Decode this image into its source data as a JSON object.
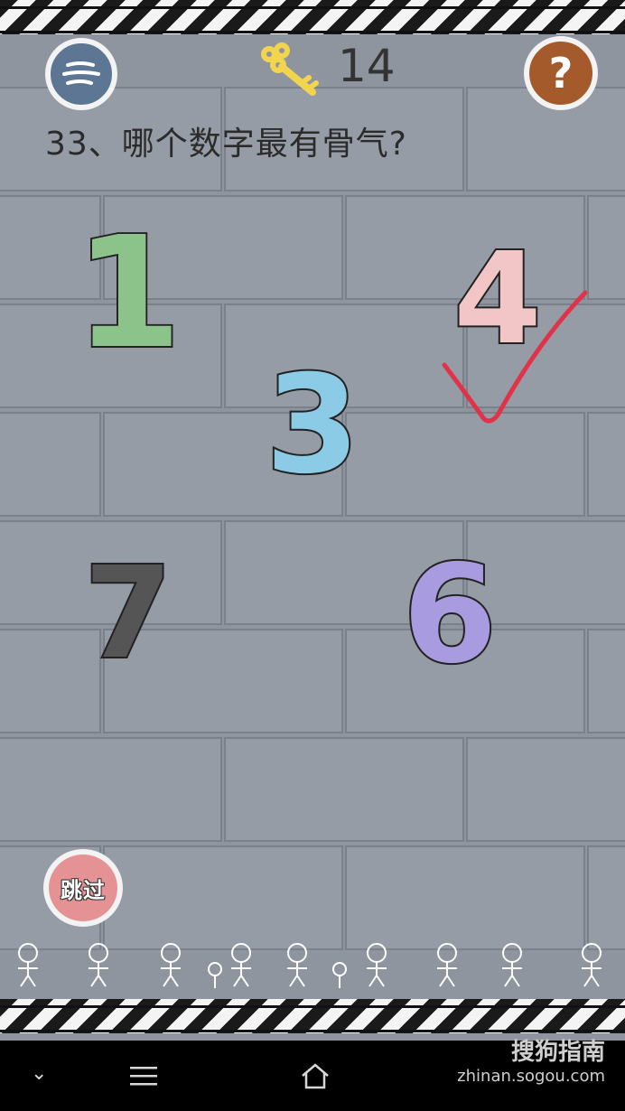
{
  "header": {
    "key_count": "14",
    "help_label": "?"
  },
  "question": {
    "text": "33、哪个数字最有骨气?"
  },
  "choices": [
    "1",
    "4",
    "3",
    "7",
    "6"
  ],
  "correct_choice": "4",
  "skip_button": {
    "label": "跳过"
  },
  "watermark": {
    "title": "搜狗指南",
    "url": "zhinan.sogou.com"
  },
  "colors": {
    "wall": "#8e959f",
    "check_mark": "#e0334a",
    "key": "#f2d44e",
    "menu_button": "#5d7693",
    "help_button": "#a45a2a",
    "skip_button": "#e59294"
  },
  "icons": [
    "menu-icon",
    "key-icon",
    "help-icon",
    "check-mark-icon",
    "stick-figure-icon",
    "flower-icon",
    "nav-back-icon",
    "nav-menu-icon",
    "nav-home-icon"
  ]
}
